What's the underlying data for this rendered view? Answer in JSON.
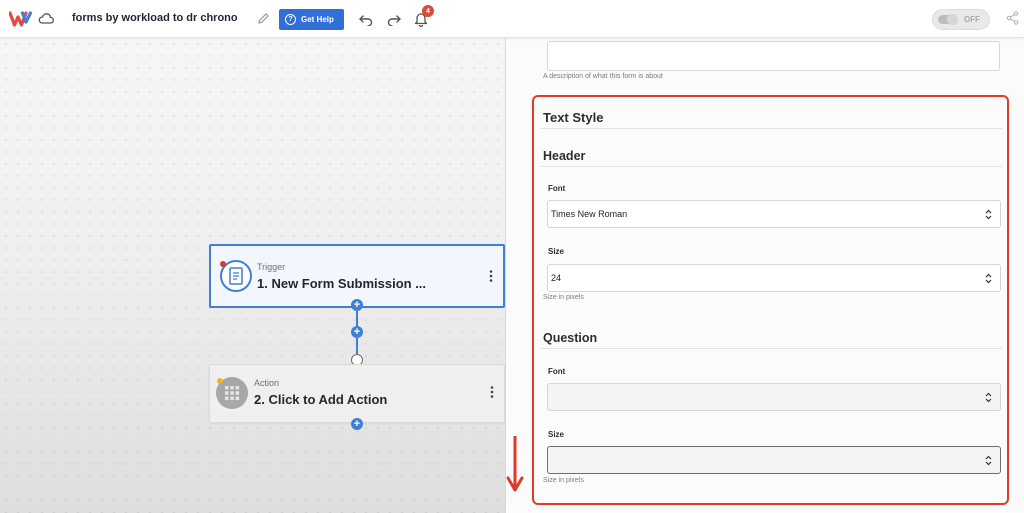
{
  "topbar": {
    "app_title": "forms by workload to dr chrono",
    "help_button_label": "Get Help",
    "notification_count": "4",
    "toggle_label": "OFF",
    "brand_color": "#e24a3f",
    "accent_color": "#2f6fd6",
    "icons": [
      "workload-logo-icon",
      "cloud-icon",
      "pencil-icon",
      "help-circle-icon",
      "undo-icon",
      "redo-icon",
      "bell-icon",
      "share-icon"
    ]
  },
  "canvas": {
    "nodes": [
      {
        "kind": "Trigger",
        "title": "1. New Form Submission ...",
        "status": "error",
        "icon": "form-document-icon"
      },
      {
        "kind": "Action",
        "title": "2. Click to Add Action",
        "status": "warning",
        "icon": "app-grid-icon"
      }
    ],
    "plus_symbol": "+"
  },
  "panel": {
    "description_help": "A description of what this form is about",
    "text_style_title": "Text Style",
    "header": {
      "title": "Header",
      "font_label": "Font",
      "font_value": "Times New Roman",
      "size_label": "Size",
      "size_value": "24",
      "size_help": "Size in pixels"
    },
    "question": {
      "title": "Question",
      "font_label": "Font",
      "font_value": "",
      "size_label": "Size",
      "size_value": "",
      "size_help": "Size in pixels"
    },
    "highlight_color": "#df3b2c"
  }
}
